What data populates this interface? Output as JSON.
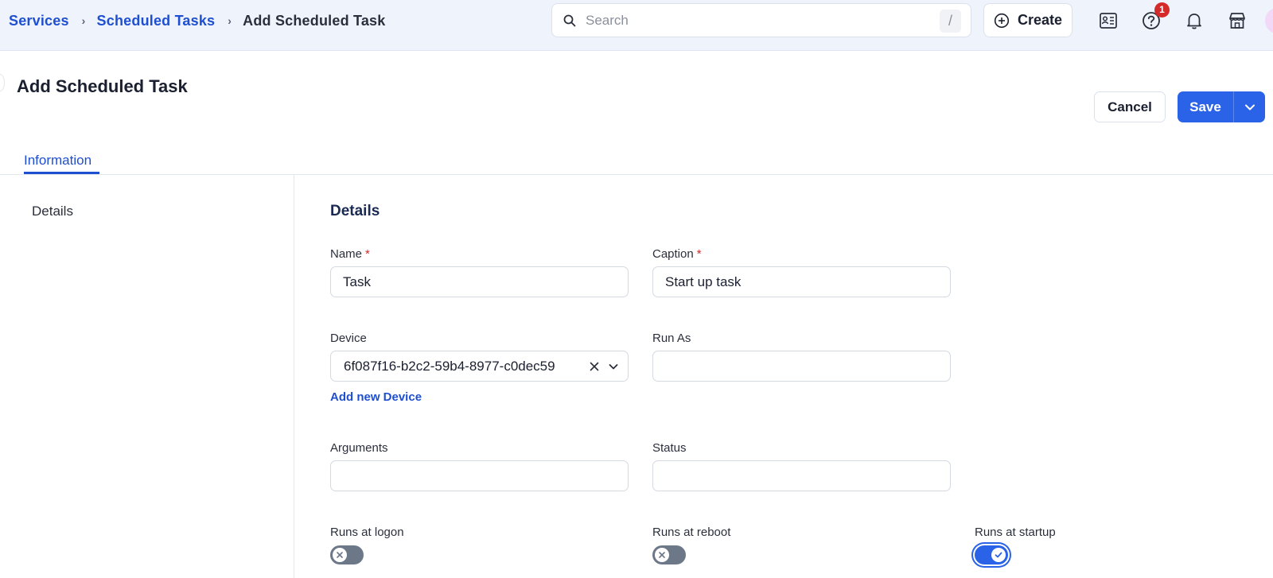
{
  "breadcrumb": {
    "items": [
      "Services",
      "Scheduled Tasks"
    ],
    "current": "Add Scheduled Task",
    "separator": "›"
  },
  "search": {
    "placeholder": "Search",
    "shortcut": "/"
  },
  "header_actions": {
    "create_label": "Create",
    "help_badge_count": "1",
    "icons": [
      "contact-list-icon",
      "help-icon",
      "bell-icon",
      "store-icon",
      "avatar"
    ]
  },
  "page": {
    "title": "Add Scheduled Task",
    "cancel_label": "Cancel",
    "save_label": "Save"
  },
  "tabs": [
    {
      "label": "Information",
      "active": true
    }
  ],
  "sidebar": {
    "items": [
      {
        "label": "Details"
      }
    ]
  },
  "form": {
    "section_title": "Details",
    "name": {
      "label": "Name",
      "required_mark": "*",
      "value": "Task"
    },
    "caption": {
      "label": "Caption",
      "required_mark": "*",
      "value": "Start up task"
    },
    "device": {
      "label": "Device",
      "value": "6f087f16-b2c2-59b4-8977-c0dec59",
      "add_link": "Add new Device"
    },
    "run_as": {
      "label": "Run As",
      "value": ""
    },
    "arguments": {
      "label": "Arguments",
      "value": ""
    },
    "status": {
      "label": "Status",
      "value": ""
    },
    "runs_at_logon": {
      "label": "Runs at logon",
      "on": false
    },
    "runs_at_reboot": {
      "label": "Runs at reboot",
      "on": false
    },
    "runs_at_startup": {
      "label": "Runs at startup",
      "on": true
    }
  },
  "colors": {
    "accent": "#2a63e8",
    "link": "#1f4fd1",
    "topbar_bg": "#eef3fc",
    "badge": "#d42a2a",
    "toggle_off": "#6c7788"
  }
}
